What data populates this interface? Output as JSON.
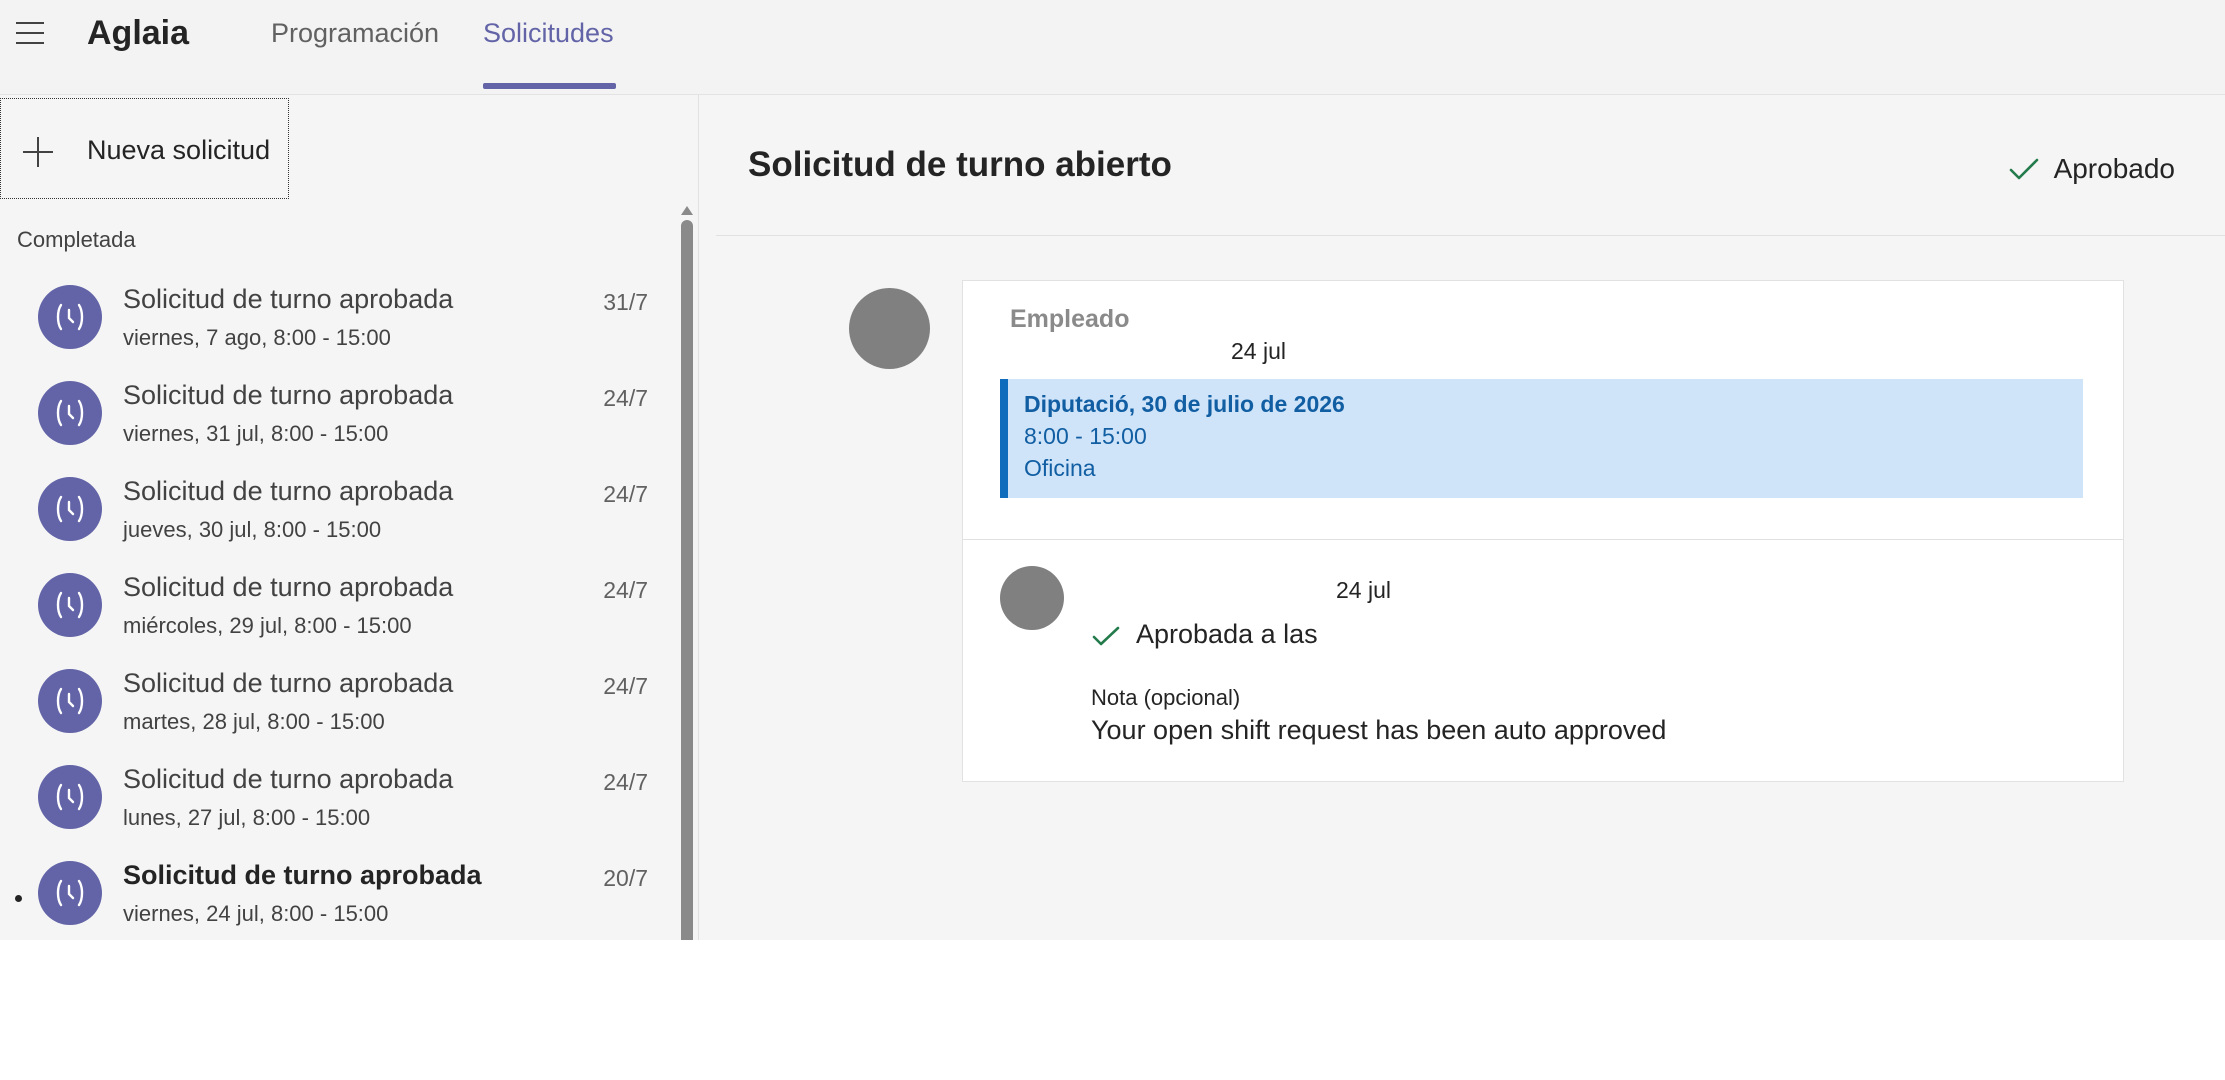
{
  "header": {
    "app_title": "Aglaia",
    "tabs": [
      {
        "label": "Programación",
        "active": false
      },
      {
        "label": "Solicitudes",
        "active": true
      }
    ],
    "accent_color": "#6264a7"
  },
  "sidebar": {
    "new_request_label": "Nueva solicitud",
    "section_label": "Completada",
    "items": [
      {
        "title": "Solicitud de turno aprobada",
        "subtitle": "viernes, 7 ago, 8:00 - 15:00",
        "date": "31/7",
        "icon": "open-shift-icon",
        "selected": false
      },
      {
        "title": "Solicitud de turno aprobada",
        "subtitle": "viernes, 31 jul, 8:00 - 15:00",
        "date": "24/7",
        "icon": "open-shift-icon",
        "selected": false
      },
      {
        "title": "Solicitud de turno aprobada",
        "subtitle": "jueves, 30 jul, 8:00 - 15:00",
        "date": "24/7",
        "icon": "open-shift-icon",
        "selected": false
      },
      {
        "title": "Solicitud de turno aprobada",
        "subtitle": "miércoles, 29 jul, 8:00 - 15:00",
        "date": "24/7",
        "icon": "open-shift-icon",
        "selected": false
      },
      {
        "title": "Solicitud de turno aprobada",
        "subtitle": "martes, 28 jul, 8:00 - 15:00",
        "date": "24/7",
        "icon": "open-shift-icon",
        "selected": false
      },
      {
        "title": "Solicitud de turno aprobada",
        "subtitle": "lunes, 27 jul, 8:00 - 15:00",
        "date": "24/7",
        "icon": "open-shift-icon",
        "selected": false
      },
      {
        "title": "Solicitud de turno aprobada",
        "subtitle": "viernes, 24 jul, 8:00 - 15:00",
        "date": "20/7",
        "icon": "open-shift-icon",
        "selected": true
      }
    ]
  },
  "detail": {
    "title": "Solicitud de turno abierto",
    "status": "Aprobado",
    "status_color": "#237b4b",
    "employee": {
      "label": "Empleado",
      "date": "24 jul"
    },
    "shift": {
      "title": "Diputació, 30 de julio de 2026",
      "time": "8:00 - 15:00",
      "location": "Oficina",
      "color": "#0f6cbd"
    },
    "manager": {
      "date": "24 jul",
      "approved_text": "Aprobada a las",
      "note_label": "Nota (opcional)",
      "note_text": "Your open shift request has been auto approved"
    }
  }
}
